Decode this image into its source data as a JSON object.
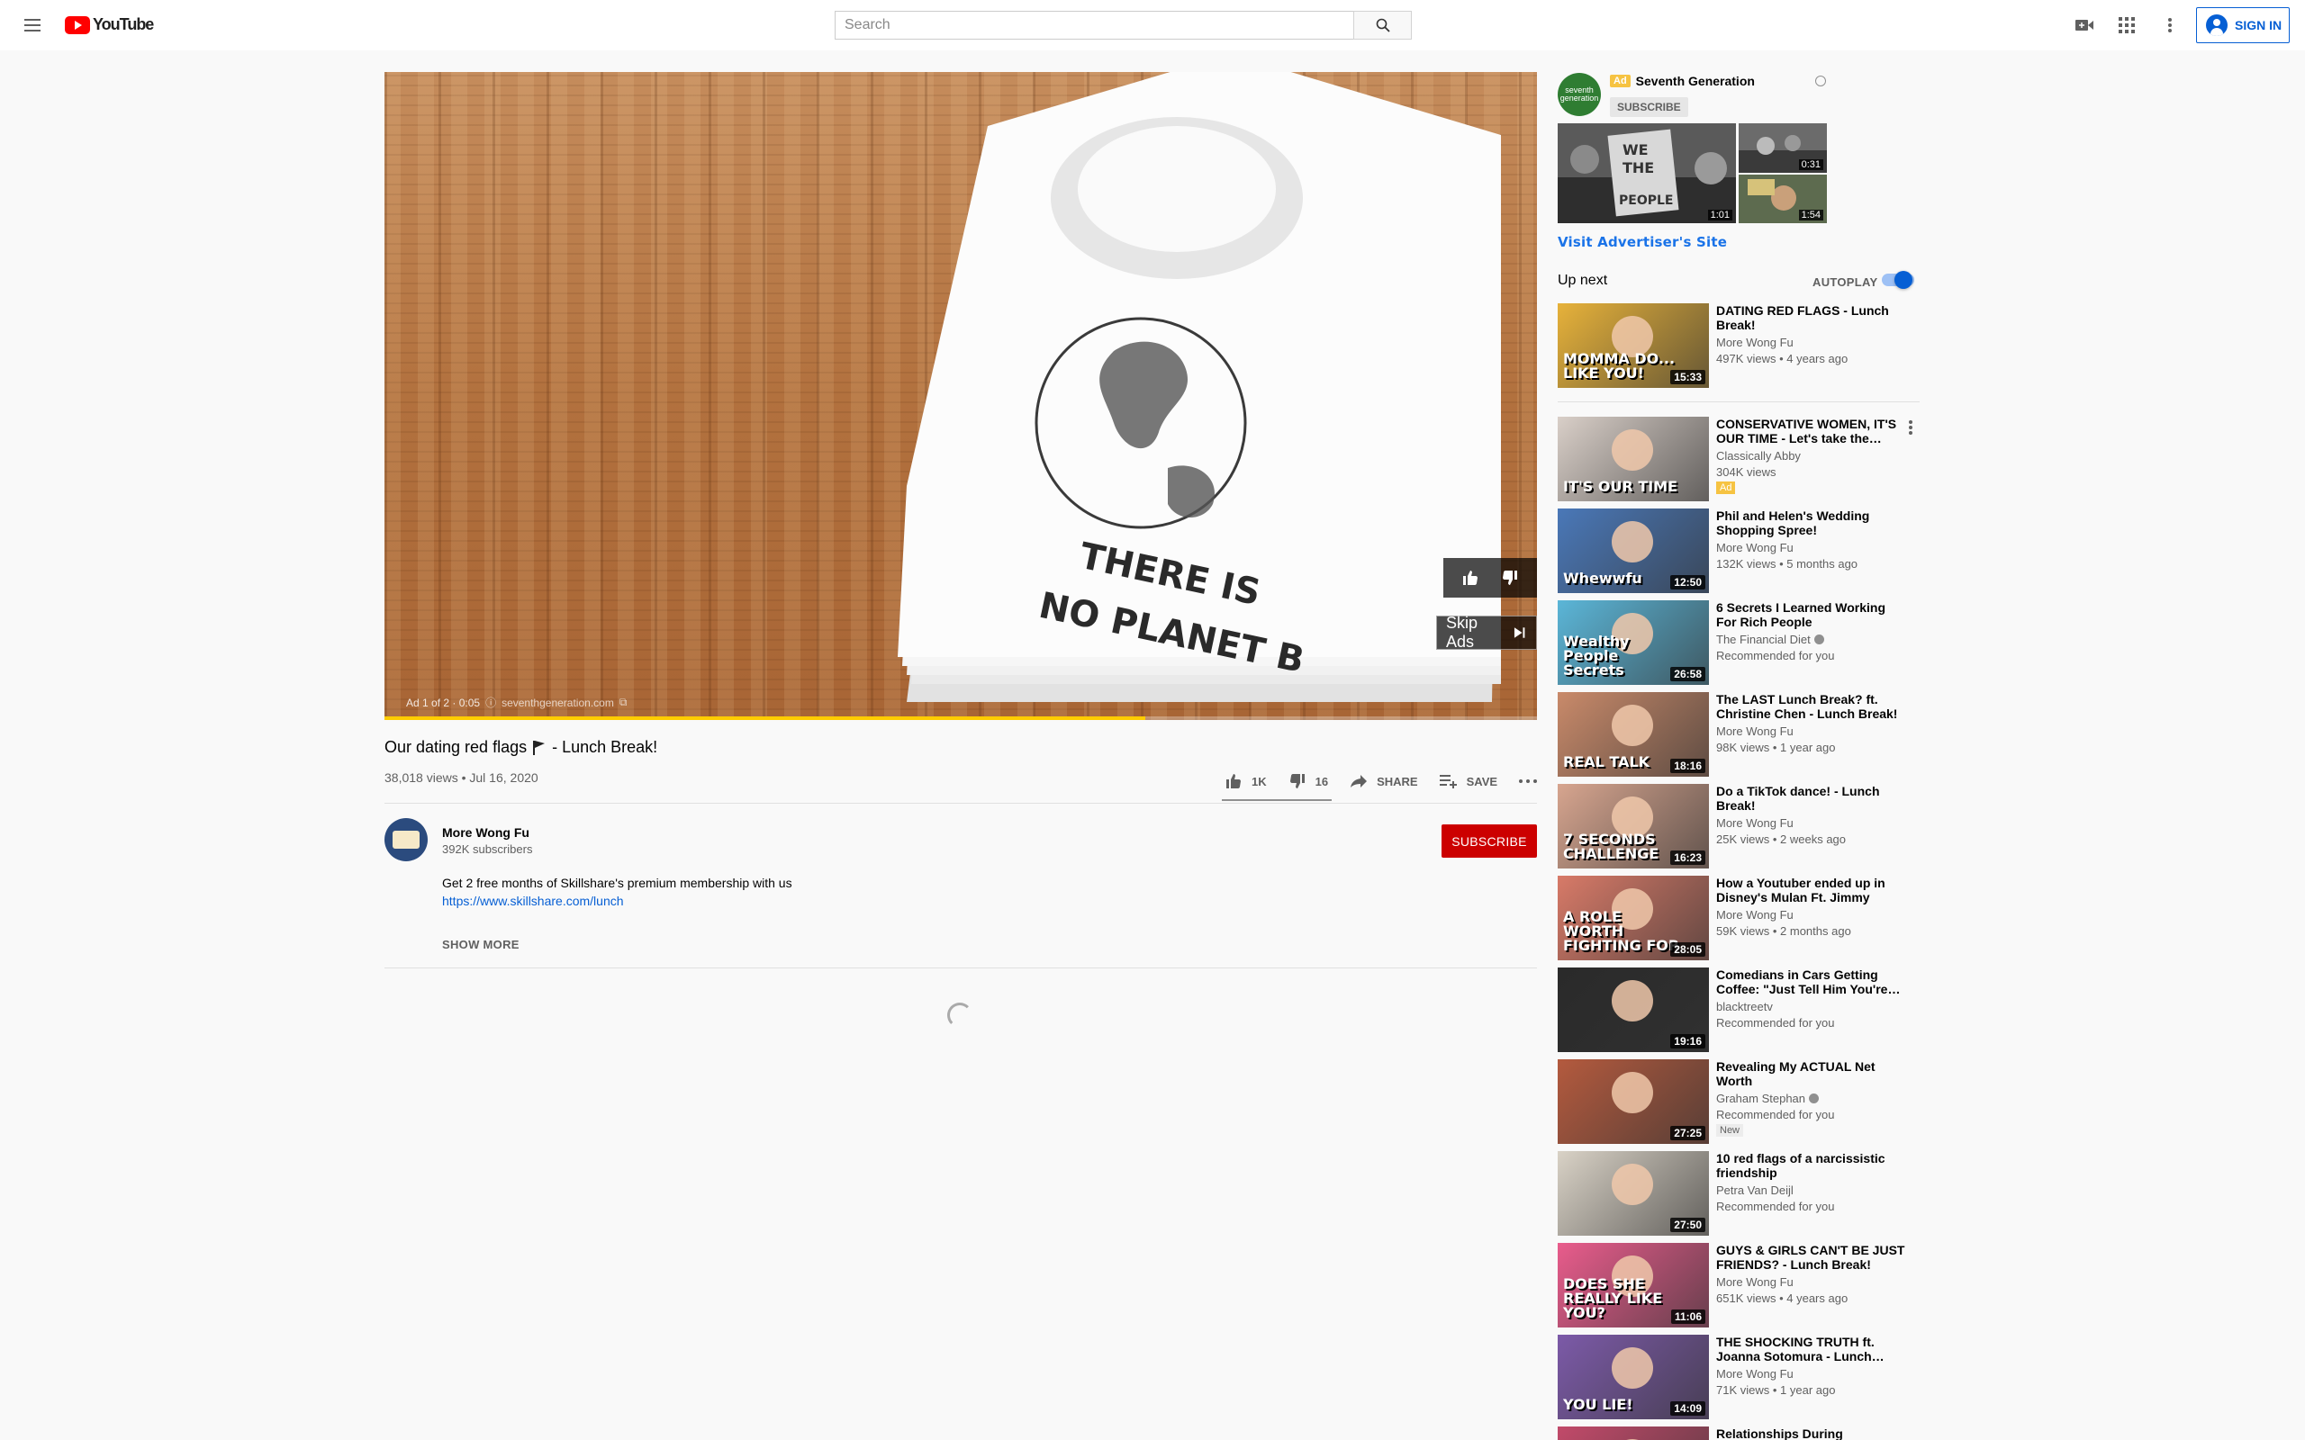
{
  "header": {
    "logo_text": "YouTube",
    "search_placeholder": "Search",
    "signin_label": "SIGN IN"
  },
  "player": {
    "ad_counter": "Ad 1 of 2 · 0:05",
    "ad_domain": "seventhgeneration.com",
    "skip_label": "Skip Ads",
    "progress_fraction": 0.66,
    "shirt_line1": "THERE IS",
    "shirt_line2": "NO PLANET B"
  },
  "video": {
    "title_before": "Our dating red flags",
    "title_after": "- Lunch Break!",
    "views_date": "38,018 views • Jul 16, 2020",
    "likes": "1K",
    "dislikes": "16",
    "share_label": "SHARE",
    "save_label": "SAVE"
  },
  "channel": {
    "name": "More Wong Fu",
    "subs": "392K subscribers",
    "subscribe_label": "SUBSCRIBE",
    "desc_line1": "Get 2 free months of Skillshare's premium membership with us",
    "desc_link": "https://www.skillshare.com/lunch",
    "show_more": "SHOW MORE"
  },
  "advertiser": {
    "logo_text": "seventh generation",
    "ad_label": "Ad",
    "name": "Seventh Generation",
    "subscribe_label": "SUBSCRIBE",
    "big_duration": "1:01",
    "small1_duration": "0:31",
    "small2_duration": "1:54",
    "visit_label": "Visit Advertiser's Site"
  },
  "upnext": {
    "label": "Up next",
    "autoplay_label": "AUTOPLAY",
    "autoplay_on": true
  },
  "recommendations": [
    {
      "title": "DATING RED FLAGS - Lunch Break!",
      "channel": "More Wong Fu",
      "meta": "497K views • 4 years ago",
      "duration": "15:33",
      "thumb_text": "MOMMA DO... LIKE YOU!",
      "thumb_color": "#e7b23a"
    },
    {
      "title": "CONSERVATIVE WOMEN, IT'S OUR TIME - Let's take the…",
      "channel": "Classically Abby",
      "meta": "304K views",
      "badge": "Ad",
      "duration": "",
      "thumb_text": "IT'S OUR TIME",
      "thumb_color": "#d9cfc8"
    },
    {
      "title": "Phil and Helen's Wedding Shopping Spree!",
      "channel": "More Wong Fu",
      "meta": "132K views • 5 months ago",
      "duration": "12:50",
      "thumb_text": "Whewwfu",
      "thumb_color": "#4a78b8"
    },
    {
      "title": "6 Secrets I Learned Working For Rich People",
      "channel": "The Financial Diet",
      "meta": "Recommended for you",
      "duration": "26:58",
      "thumb_text": "Wealthy People Secrets",
      "thumb_color": "#5bb6d8",
      "verified": true
    },
    {
      "title": "The LAST Lunch Break? ft. Christine Chen - Lunch Break!",
      "channel": "More Wong Fu",
      "meta": "98K views • 1 year ago",
      "duration": "18:16",
      "thumb_text": "REAL TALK",
      "thumb_color": "#c98a6a"
    },
    {
      "title": "Do a TikTok dance! - Lunch Break!",
      "channel": "More Wong Fu",
      "meta": "25K views • 2 weeks ago",
      "duration": "16:23",
      "thumb_text": "7 SECONDS CHALLENGE",
      "thumb_color": "#d7a58f"
    },
    {
      "title": "How a Youtuber ended up in Disney's Mulan Ft. Jimmy Won…",
      "channel": "More Wong Fu",
      "meta": "59K views • 2 months ago",
      "duration": "28:05",
      "thumb_text": "A ROLE WORTH FIGHTING FOR",
      "thumb_color": "#d87a68"
    },
    {
      "title": "Comedians in Cars Getting Coffee: \"Just Tell Him You're…",
      "channel": "blacktreetv",
      "meta": "Recommended for you",
      "duration": "19:16",
      "thumb_text": "",
      "thumb_color": "#2a2a2a"
    },
    {
      "title": "Revealing My ACTUAL Net Worth",
      "channel": "Graham Stephan",
      "meta": "Recommended for you",
      "badge": "New",
      "duration": "27:25",
      "thumb_text": "",
      "thumb_color": "#b45a3e",
      "verified": true
    },
    {
      "title": "10 red flags of a narcissistic friendship",
      "channel": "Petra Van Deijl",
      "meta": "Recommended for you",
      "duration": "27:50",
      "thumb_text": "",
      "thumb_color": "#d9d2c6"
    },
    {
      "title": "GUYS & GIRLS CAN'T BE JUST FRIENDS? - Lunch Break!",
      "channel": "More Wong Fu",
      "meta": "651K views • 4 years ago",
      "duration": "11:06",
      "thumb_text": "DOES SHE REALLY LIKE YOU?",
      "thumb_color": "#e95c8c"
    },
    {
      "title": "THE SHOCKING TRUTH ft. Joanna Sotomura - Lunch…",
      "channel": "More Wong Fu",
      "meta": "71K views • 1 year ago",
      "duration": "14:09",
      "thumb_text": "YOU LIE!",
      "thumb_color": "#7c5aa8"
    },
    {
      "title": "Relationships During",
      "channel": "",
      "meta": "",
      "duration": "",
      "thumb_text": "",
      "thumb_color": "#c24a6a"
    }
  ]
}
